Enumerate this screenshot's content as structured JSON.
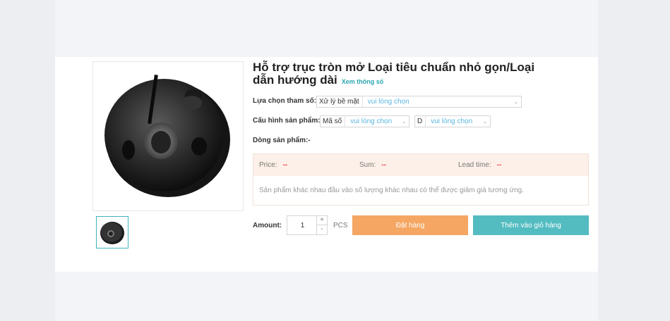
{
  "product": {
    "title": "Hỗ trợ trục tròn mở Loại tiêu chuẩn nhỏ gọn/Loại dẫn hướng dài",
    "spec_link": "Xem thông số",
    "image": "black-split-shaft-collar"
  },
  "param": {
    "label": "Lựa chọn tham số:",
    "surface_prefix": "Xử lý bề mặt",
    "surface_value": "vui lòng chọn"
  },
  "config": {
    "label": "Cấu hình sản phẩm:",
    "code_prefix": "Mã số",
    "code_value": "vui lòng chọn",
    "d_prefix": "D",
    "d_value": "vui lòng chọn"
  },
  "series": {
    "label": "Dòng sản phẩm:",
    "value": "-"
  },
  "pricing": {
    "price_label": "Price:",
    "price_value": "--",
    "sum_label": "Sum:",
    "sum_value": "--",
    "lead_label": "Lead time:",
    "lead_value": "--",
    "note": "Sản phẩm khác nhau đầu vào số lượng khác nhau có thể được giảm giá tương ứng."
  },
  "purchase": {
    "amount_label": "Amount:",
    "quantity": "1",
    "plus": "+",
    "minus": "-",
    "unit": "PCS",
    "order_button": "Đặt hàng",
    "cart_button": "Thêm vào giỏ hàng"
  },
  "colors": {
    "accent": "#53bcc1",
    "order": "#f5a662",
    "price_red": "#e8413f",
    "select_text": "#5bb7e0"
  },
  "icons": {
    "chevron": "chevron-down-icon"
  }
}
